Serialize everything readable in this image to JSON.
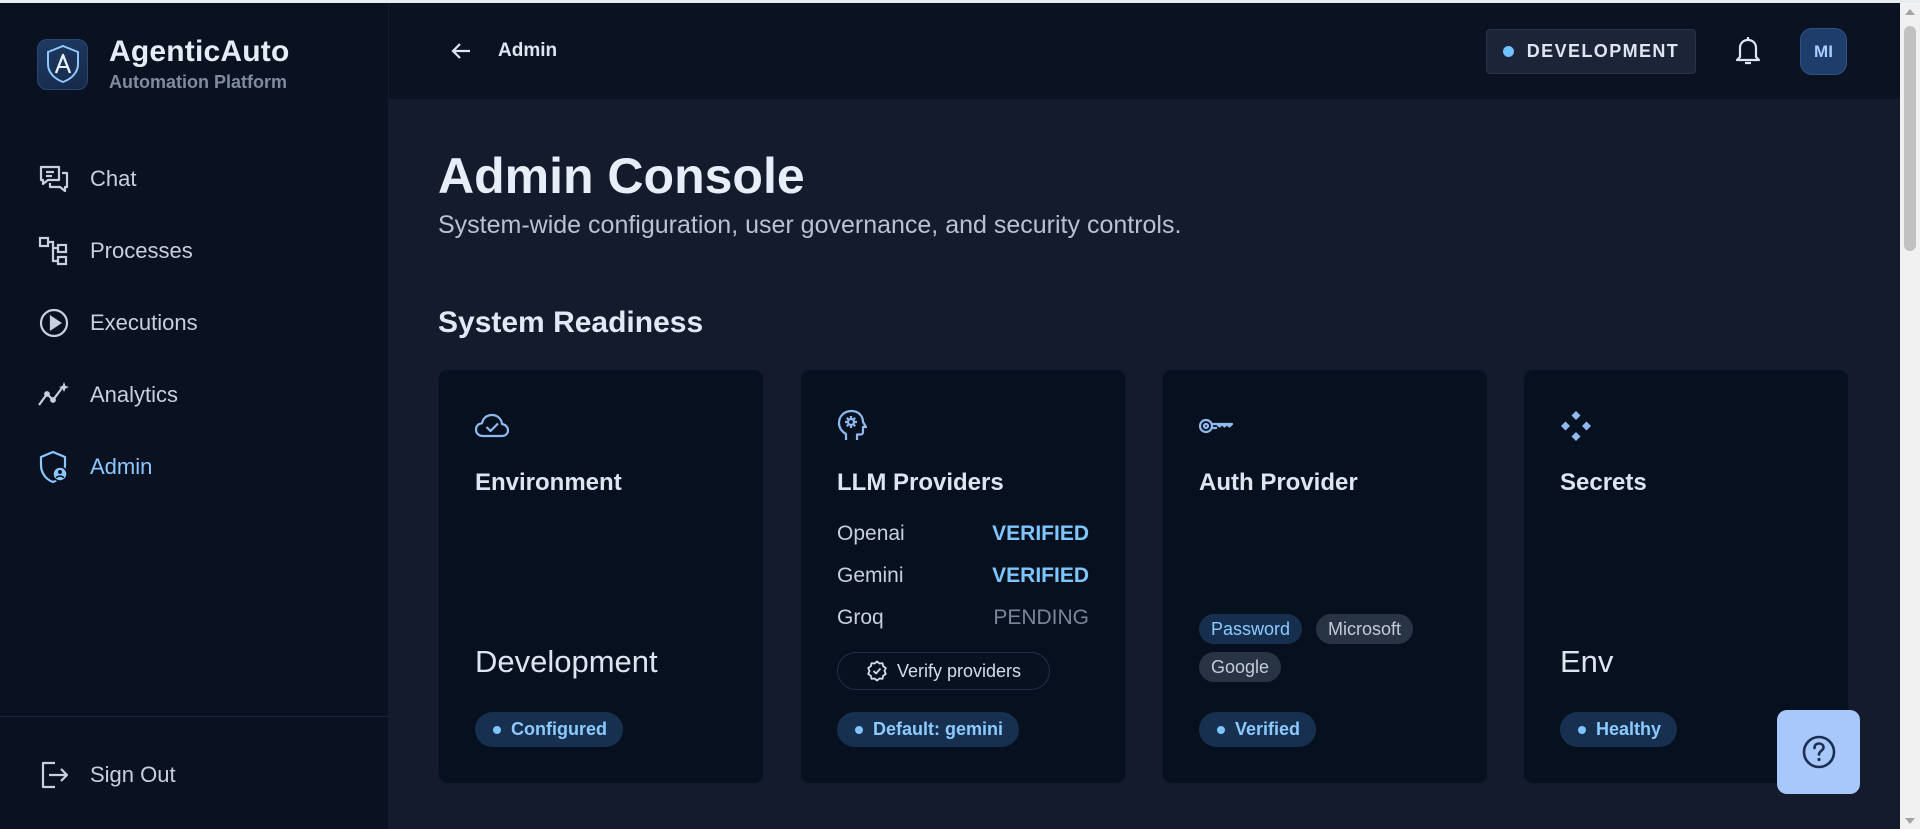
{
  "brand": {
    "name": "AgenticAuto",
    "subtitle": "Automation Platform"
  },
  "sidebar": {
    "items": [
      {
        "label": "Chat",
        "icon": "chat-icon",
        "active": false
      },
      {
        "label": "Processes",
        "icon": "process-tree-icon",
        "active": false
      },
      {
        "label": "Executions",
        "icon": "play-circle-icon",
        "active": false
      },
      {
        "label": "Analytics",
        "icon": "analytics-icon",
        "active": false
      },
      {
        "label": "Admin",
        "icon": "admin-shield-icon",
        "active": true
      }
    ],
    "signout_label": "Sign Out"
  },
  "header": {
    "title": "Admin",
    "environment": "DEVELOPMENT",
    "avatar_initials": "MI"
  },
  "page": {
    "title": "Admin Console",
    "subtitle": "System-wide configuration, user governance, and security controls.",
    "section_title": "System Readiness"
  },
  "cards": {
    "environment": {
      "title": "Environment",
      "value": "Development",
      "badge": "Configured"
    },
    "llm": {
      "title": "LLM Providers",
      "providers": [
        {
          "name": "Openai",
          "status": "VERIFIED"
        },
        {
          "name": "Gemini",
          "status": "VERIFIED"
        },
        {
          "name": "Groq",
          "status": "PENDING"
        }
      ],
      "verify_label": "Verify providers",
      "badge": "Default: gemini"
    },
    "auth": {
      "title": "Auth Provider",
      "methods": [
        "Password",
        "Microsoft",
        "Google"
      ],
      "badge": "Verified"
    },
    "secrets": {
      "title": "Secrets",
      "value": "Env",
      "badge": "Healthy"
    }
  },
  "colors": {
    "accent": "#7fc6ff",
    "sidebar_bg": "#0a1222",
    "main_bg": "#131b2c",
    "card_bg": "#07101e",
    "help_button": "#a8c8fb"
  }
}
